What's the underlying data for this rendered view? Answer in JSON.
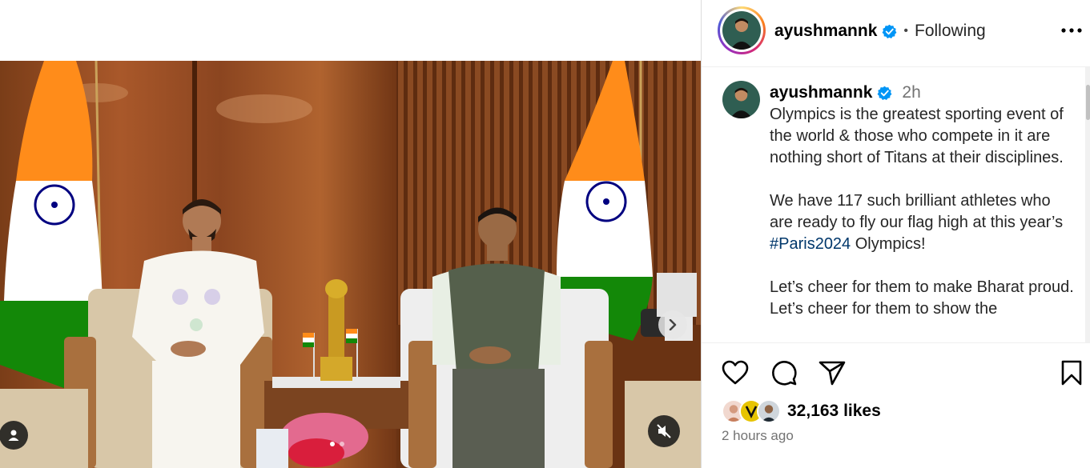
{
  "post": {
    "username": "ayushmannk",
    "follow_status": "Following",
    "separator": "•",
    "caption": {
      "username": "ayushmannk",
      "age": "2h",
      "paragraph1": "Olympics is the greatest sporting event of the world & those who compete in it are nothing short of Titans at their disciplines.",
      "paragraph2_before": "We have 117 such brilliant athletes who are ready to fly our flag high at this year’s ",
      "hashtag": "#Paris2024",
      "paragraph2_after": " Olympics!",
      "paragraph3": "Let’s cheer for them to make Bharat proud. Let’s cheer for them to show the"
    },
    "likes": "32,163 likes",
    "posted": "2 hours ago",
    "carousel": {
      "slide_count": 2,
      "active_slide": 1
    }
  },
  "icons": {
    "more": "more-horizontal-icon",
    "verified": "verified-badge-icon",
    "like": "heart-icon",
    "comment": "comment-icon",
    "share": "share-icon",
    "save": "bookmark-icon",
    "next": "chevron-right-icon",
    "tag": "user-tag-icon",
    "mute": "speaker-muted-icon"
  },
  "colors": {
    "verified": "#0095f6",
    "hashtag": "#00376b",
    "muted_text": "#737373",
    "saffron": "#ff8c1a",
    "green": "#138808",
    "chakra": "#000080"
  }
}
